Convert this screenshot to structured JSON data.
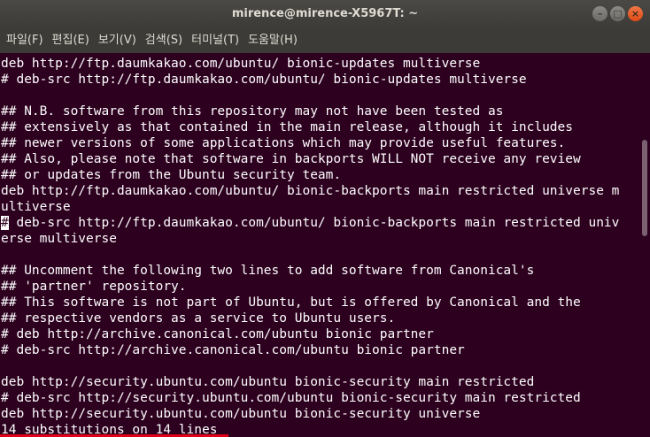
{
  "window": {
    "title": "mirence@mirence-X5967T: ~"
  },
  "menu": [
    "파일(F)",
    "편집(E)",
    "보기(V)",
    "검색(S)",
    "터미널(T)",
    "도움말(H)"
  ],
  "terminal": {
    "lines": [
      "deb http://ftp.daumkakao.com/ubuntu/ bionic-updates multiverse",
      "# deb-src http://ftp.daumkakao.com/ubuntu/ bionic-updates multiverse",
      "",
      "## N.B. software from this repository may not have been tested as",
      "## extensively as that contained in the main release, although it includes",
      "## newer versions of some applications which may provide useful features.",
      "## Also, please note that software in backports WILL NOT receive any review",
      "## or updates from the Ubuntu security team.",
      "deb http://ftp.daumkakao.com/ubuntu/ bionic-backports main restricted universe m",
      "ultiverse",
      "# deb-src http://ftp.daumkakao.com/ubuntu/ bionic-backports main restricted univ",
      "erse multiverse",
      "",
      "## Uncomment the following two lines to add software from Canonical's",
      "## 'partner' repository.",
      "## This software is not part of Ubuntu, but is offered by Canonical and the",
      "## respective vendors as a service to Ubuntu users.",
      "# deb http://archive.canonical.com/ubuntu bionic partner",
      "# deb-src http://archive.canonical.com/ubuntu bionic partner",
      "",
      "deb http://security.ubuntu.com/ubuntu bionic-security main restricted",
      "# deb-src http://security.ubuntu.com/ubuntu bionic-security main restricted",
      "deb http://security.ubuntu.com/ubuntu bionic-security universe"
    ],
    "cursor_line": 10,
    "status": "14 substitutions on 14 lines"
  },
  "scrollbar": {
    "position": 0.3,
    "visible_fraction": 0.25
  },
  "colors": {
    "background": "#2c001e",
    "foreground": "#ffffff",
    "highlight": "#e0001b"
  }
}
